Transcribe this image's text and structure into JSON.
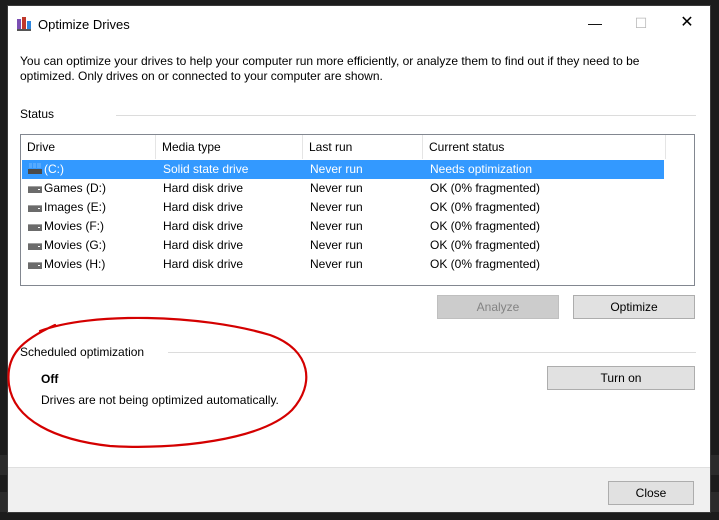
{
  "window": {
    "title": "Optimize Drives",
    "minimize_glyph": "—",
    "maximize_glyph": "☐",
    "close_glyph": "✕"
  },
  "description": "You can optimize your drives to help your computer run more efficiently, or analyze them to find out if they need to be optimized. Only drives on or connected to your computer are shown.",
  "status": {
    "label": "Status",
    "columns": [
      "Drive",
      "Media type",
      "Last run",
      "Current status"
    ],
    "drives": [
      {
        "name": "(C:)",
        "media": "Solid state drive",
        "last_run": "Never run",
        "status": "Needs optimization",
        "icon": "ssd-icon",
        "selected": true
      },
      {
        "name": "Games (D:)",
        "media": "Hard disk drive",
        "last_run": "Never run",
        "status": "OK (0% fragmented)",
        "icon": "hard-drive-icon",
        "selected": false
      },
      {
        "name": "Images (E:)",
        "media": "Hard disk drive",
        "last_run": "Never run",
        "status": "OK (0% fragmented)",
        "icon": "hard-drive-icon",
        "selected": false
      },
      {
        "name": "Movies (F:)",
        "media": "Hard disk drive",
        "last_run": "Never run",
        "status": "OK (0% fragmented)",
        "icon": "hard-drive-icon",
        "selected": false
      },
      {
        "name": "Movies (G:)",
        "media": "Hard disk drive",
        "last_run": "Never run",
        "status": "OK (0% fragmented)",
        "icon": "hard-drive-icon",
        "selected": false
      },
      {
        "name": "Movies (H:)",
        "media": "Hard disk drive",
        "last_run": "Never run",
        "status": "OK (0% fragmented)",
        "icon": "hard-drive-icon",
        "selected": false
      }
    ],
    "analyze_label": "Analyze",
    "optimize_label": "Optimize"
  },
  "scheduled": {
    "label": "Scheduled optimization",
    "state": "Off",
    "description": "Drives are not being optimized automatically.",
    "turn_on_label": "Turn on"
  },
  "footer": {
    "close_label": "Close"
  },
  "colors": {
    "selection": "#3399ff",
    "annotation": "#d40000"
  }
}
